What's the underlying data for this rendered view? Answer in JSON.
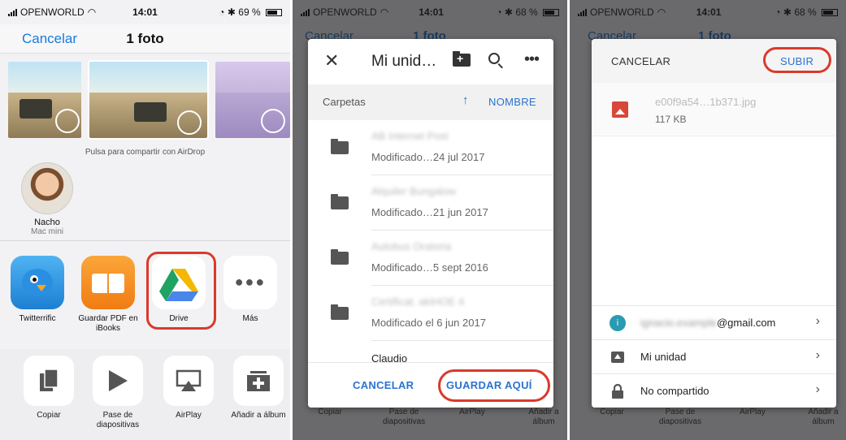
{
  "status": {
    "carrier": "OPENWORLD",
    "time": "14:01",
    "battery_p1": "69 %",
    "battery_p2": "68 %",
    "battery_p3": "68 %"
  },
  "share_sheet": {
    "cancel_label": "Cancelar",
    "title": "1 foto",
    "airdrop_hint": "Pulsa para compartir con AirDrop",
    "contact": {
      "name": "Nacho",
      "device": "Mac mini"
    },
    "apps": [
      {
        "label": "Twitterrific"
      },
      {
        "label": "Guardar PDF en iBooks"
      },
      {
        "label": "Drive"
      },
      {
        "label": "Más"
      }
    ],
    "actions": [
      {
        "label": "Copiar"
      },
      {
        "label": "Pase de diapositivas"
      },
      {
        "label": "AirPlay"
      },
      {
        "label": "Añadir a álbum"
      }
    ]
  },
  "drive_picker": {
    "bg_cancel": "Cancelar",
    "bg_title": "1 foto",
    "title": "Mi unid…",
    "section_label": "Carpetas",
    "sort_label": "NOMBRE",
    "folders": [
      {
        "name": "AB Internet Post",
        "meta": "Modificado…24 jul 2017"
      },
      {
        "name": "Alquiler Bungalow",
        "meta": "Modificado…21 jun 2017"
      },
      {
        "name": "Autobus Oratoria",
        "meta": "Modificado…5 sept 2016"
      },
      {
        "name": "Certificat. akiHOE 4",
        "meta": "Modificado el 6 jun 2017"
      },
      {
        "name": "Claudio",
        "meta": ""
      }
    ],
    "cancel_label": "CANCELAR",
    "save_label": "GUARDAR AQUÍ"
  },
  "upload_dialog": {
    "bg_cancel": "Cancelar",
    "bg_title": "1 foto",
    "cancel_label": "CANCELAR",
    "upload_label": "SUBIR",
    "file_name": "e00f9a54…1b371.jpg",
    "file_size": "117 KB",
    "account": "@gmail.com",
    "account_initial": "i",
    "destination": "Mi unidad",
    "sharing": "No compartido"
  },
  "colors": {
    "accent": "#2a73d0",
    "highlight": "#d93a2b",
    "ios_blue": "#1a7ae0"
  }
}
